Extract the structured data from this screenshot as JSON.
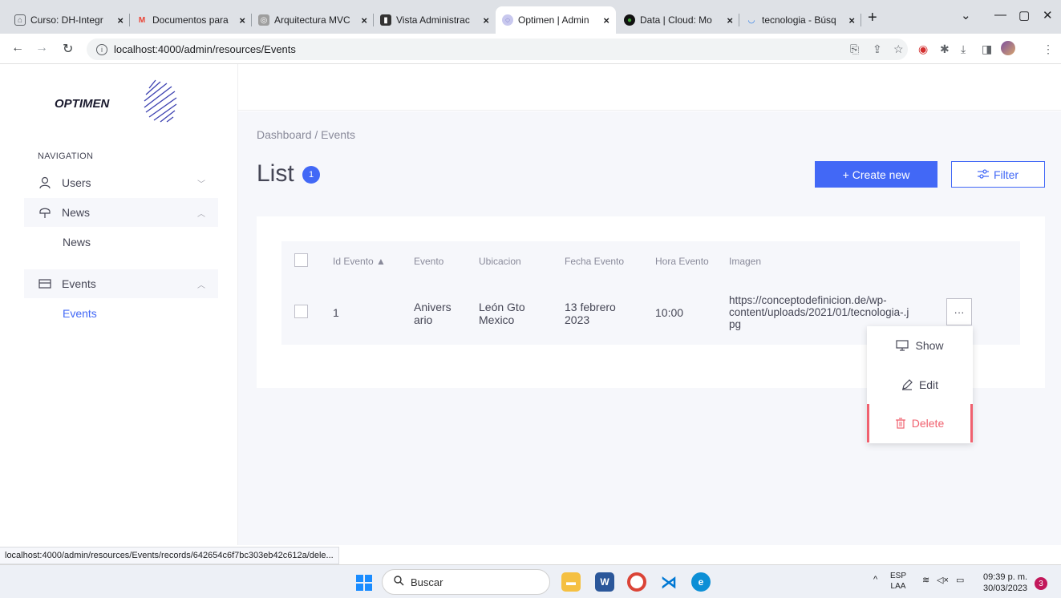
{
  "browser": {
    "tabs": [
      {
        "title": "Curso: DH-Integr",
        "icon": "course-icon"
      },
      {
        "title": "Documentos para",
        "icon": "gmail-icon"
      },
      {
        "title": "Arquitectura MVC",
        "icon": "site-icon"
      },
      {
        "title": "Vista Administrac",
        "icon": "site-icon"
      },
      {
        "title": "Optimen | Admin",
        "icon": "optimen-icon"
      },
      {
        "title": "Data | Cloud: Mo",
        "icon": "mongodb-icon"
      },
      {
        "title": "tecnologia - Búsq",
        "icon": "loading-icon"
      }
    ],
    "url": "localhost:4000/admin/resources/Events",
    "status_url": "localhost:4000/admin/resources/Events/records/642654c6f7bc303eb42c612a/dele..."
  },
  "sidebar": {
    "logo_text": "OPTIMEN",
    "nav_title": "NAVIGATION",
    "items": [
      {
        "label": "Users",
        "icon": "user-icon"
      },
      {
        "label": "News",
        "icon": "news-icon"
      },
      {
        "label": "Events",
        "icon": "events-icon"
      }
    ],
    "sub_news": "News",
    "sub_events": "Events"
  },
  "main": {
    "breadcrumb": "Dashboard / Events",
    "title": "List",
    "count": "1",
    "create_label": "+ Create new",
    "filter_label": "Filter"
  },
  "table": {
    "columns": [
      "Id Evento ▲",
      "Evento",
      "Ubicacion",
      "Fecha Evento",
      "Hora Evento",
      "Imagen"
    ],
    "rows": [
      {
        "id": "1",
        "evento_l1": "Anivers",
        "evento_l2": "ario",
        "ubicacion_l1": "León Gto",
        "ubicacion_l2": "Mexico",
        "fecha_l1": "13 febrero",
        "fecha_l2": "2023",
        "hora": "10:00",
        "imagen_l1": "https://conceptodefinicion.de/wp-",
        "imagen_l2": "content/uploads/2021/01/tecnologia-.j",
        "imagen_l3": "pg"
      }
    ],
    "more_label": "···"
  },
  "actions_menu": {
    "show": "Show",
    "edit": "Edit",
    "delete": "Delete"
  },
  "taskbar": {
    "search_placeholder": "Buscar",
    "lang_l1": "ESP",
    "lang_l2": "LAA",
    "time": "09:39 p. m.",
    "date": "30/03/2023",
    "notifications": "3"
  },
  "colors": {
    "primary": "#4268f6",
    "danger": "#f0616f",
    "muted": "#898a9a",
    "background": "#f6f7fb"
  }
}
